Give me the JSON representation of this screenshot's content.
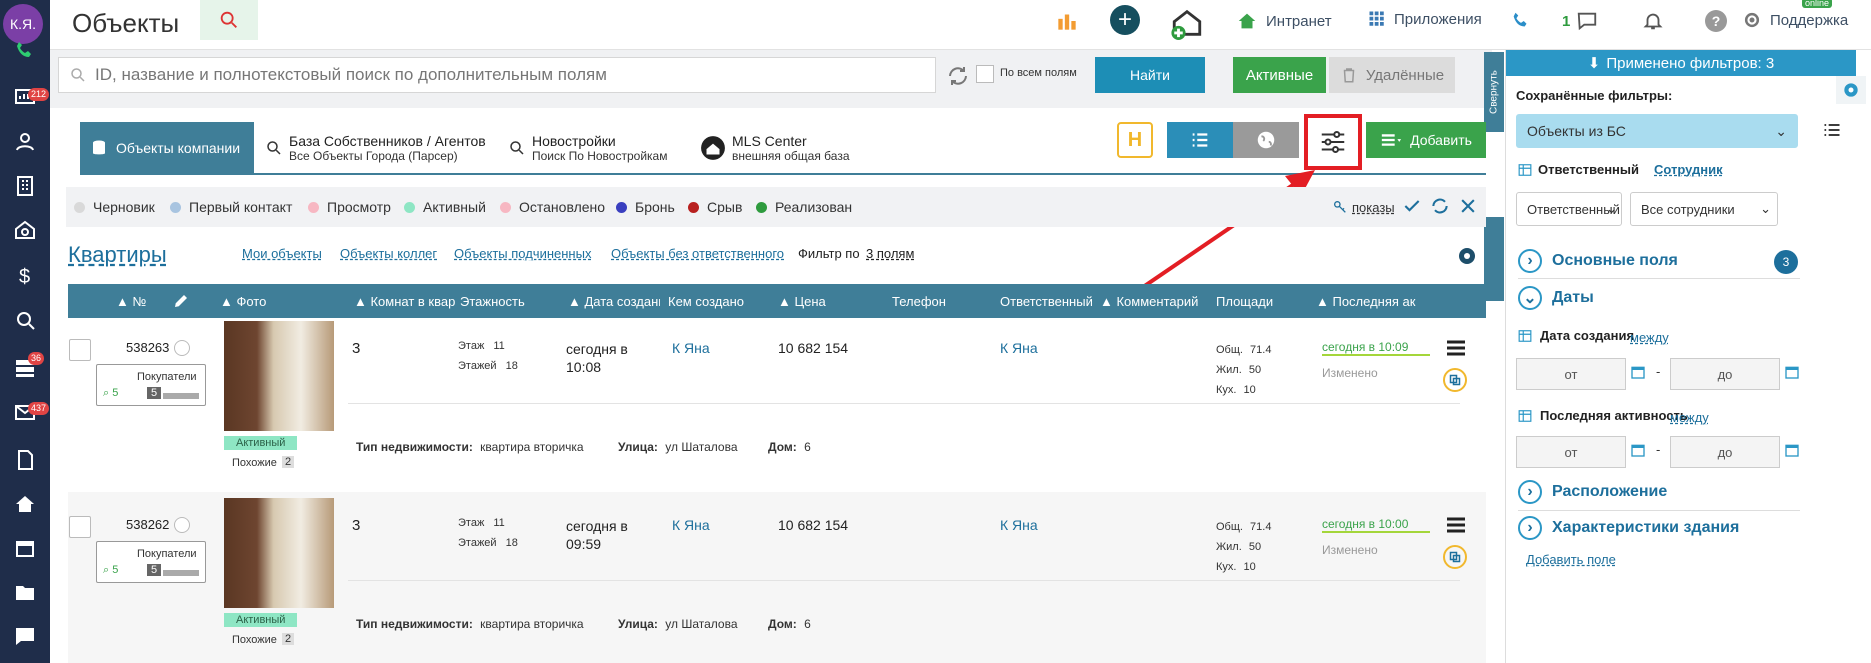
{
  "rail": {
    "avatar": "К.Я.",
    "badges": [
      "212",
      "36",
      "437"
    ]
  },
  "header": {
    "title": "Объекты",
    "nav": [
      {
        "label": "Интранет"
      },
      {
        "label": "Приложения"
      },
      {
        "label": "1"
      },
      {
        "label": "Поддержка"
      }
    ],
    "online": "online"
  },
  "search": {
    "placeholder": "ID, название и полнотекстовый поиск по дополнительным полям",
    "all_fields": "По всем полям",
    "find": "Найти",
    "active": "Активные",
    "deleted": "Удалённые",
    "collapse": "Свернуть"
  },
  "tabs": [
    {
      "title": "Объекты компании",
      "sub": ""
    },
    {
      "title": "База Собственников / Агентов",
      "sub": "Все Объекты Города (Парсер)"
    },
    {
      "title": "Новостройки",
      "sub": "Поиск По Новостройкам"
    },
    {
      "title": "MLS Center",
      "sub": "внешняя общая база"
    }
  ],
  "toolbar": {
    "add": "Добавить"
  },
  "statuses": [
    {
      "label": "Черновик",
      "color": "#d9d9d9"
    },
    {
      "label": "Первый контакт",
      "color": "#a8c4e0"
    },
    {
      "label": "Просмотр",
      "color": "#f7b7c2"
    },
    {
      "label": "Активный",
      "color": "#8ee6c4"
    },
    {
      "label": "Остановлено",
      "color": "#f7b7c2"
    },
    {
      "label": "Бронь",
      "color": "#3a3fbf"
    },
    {
      "label": "Срыв",
      "color": "#b8201f"
    },
    {
      "label": "Реализован",
      "color": "#2e9b3e"
    }
  ],
  "shows": "показы",
  "list": {
    "title": "Квартиры",
    "links": [
      "Мои объекты",
      "Объекты коллег",
      "Объекты подчиненных",
      "Объекты без ответственного"
    ],
    "filter_by": "Фильтр по",
    "filter_count": "3 полям"
  },
  "columns": [
    "№",
    "Фото",
    "Комнат в квар",
    "Этажность",
    "Дата создани",
    "Кем создано",
    "Цена",
    "Телефон",
    "Ответственный",
    "Комментарий",
    "Площади",
    "Последняя ак"
  ],
  "rows": [
    {
      "id": "538263",
      "buyers": "Покупатели",
      "buyers_a": "5",
      "buyers_b": "5",
      "status": "Активный",
      "similar": "Похожие",
      "similar_n": "2",
      "rooms": "3",
      "floor_l": "Этаж",
      "floor": "11",
      "floors_l": "Этажей",
      "floors": "18",
      "date": "сегодня в 10:08",
      "creator": "К Яна",
      "price": "10 682 154",
      "resp": "К Яна",
      "s_total_l": "Общ.",
      "s_total": "71.4",
      "s_live_l": "Жил.",
      "s_live": "50",
      "s_kit_l": "Кух.",
      "s_kit": "10",
      "last": "сегодня в 10:09",
      "changed": "Изменено",
      "type_l": "Тип недвижимости:",
      "type": "квартира вторичка",
      "street_l": "Улица:",
      "street": "ул Шаталова",
      "house_l": "Дом:",
      "house": "6"
    },
    {
      "id": "538262",
      "buyers": "Покупатели",
      "buyers_a": "5",
      "buyers_b": "5",
      "status": "Активный",
      "similar": "Похожие",
      "similar_n": "2",
      "rooms": "3",
      "floor_l": "Этаж",
      "floor": "11",
      "floors_l": "Этажей",
      "floors": "18",
      "date": "сегодня в 09:59",
      "creator": "К Яна",
      "price": "10 682 154",
      "resp": "К Яна",
      "s_total_l": "Общ.",
      "s_total": "71.4",
      "s_live_l": "Жил.",
      "s_live": "50",
      "s_kit_l": "Кух.",
      "s_kit": "10",
      "last": "сегодня в 10:00",
      "changed": "Изменено",
      "type_l": "Тип недвижимости:",
      "type": "квартира вторичка",
      "street_l": "Улица:",
      "street": "ул Шаталова",
      "house_l": "Дом:",
      "house": "6"
    }
  ],
  "panel": {
    "head": "Применено фильтров: 3",
    "saved_l": "Сохранённые фильтры:",
    "saved": "Объекты из БС",
    "resp_l": "Ответственный",
    "employee": "Сотрудник",
    "resp_sel": "Ответственный",
    "all_emp": "Все сотрудники",
    "main_fields": "Основные поля",
    "main_count": "3",
    "dates": "Даты",
    "created_l": "Дата создания",
    "between": "между",
    "from": "от",
    "to": "до",
    "dash": "-",
    "last_l": "Последняя активность",
    "location": "Расположение",
    "building": "Характеристики здания",
    "add_field": "Добавить поле"
  },
  "colors": {
    "accent": "#2b97c6",
    "green": "#3aa34b",
    "header": "#3f7e98",
    "rail": "#1f2d4a",
    "highlight": "#e31e24"
  }
}
